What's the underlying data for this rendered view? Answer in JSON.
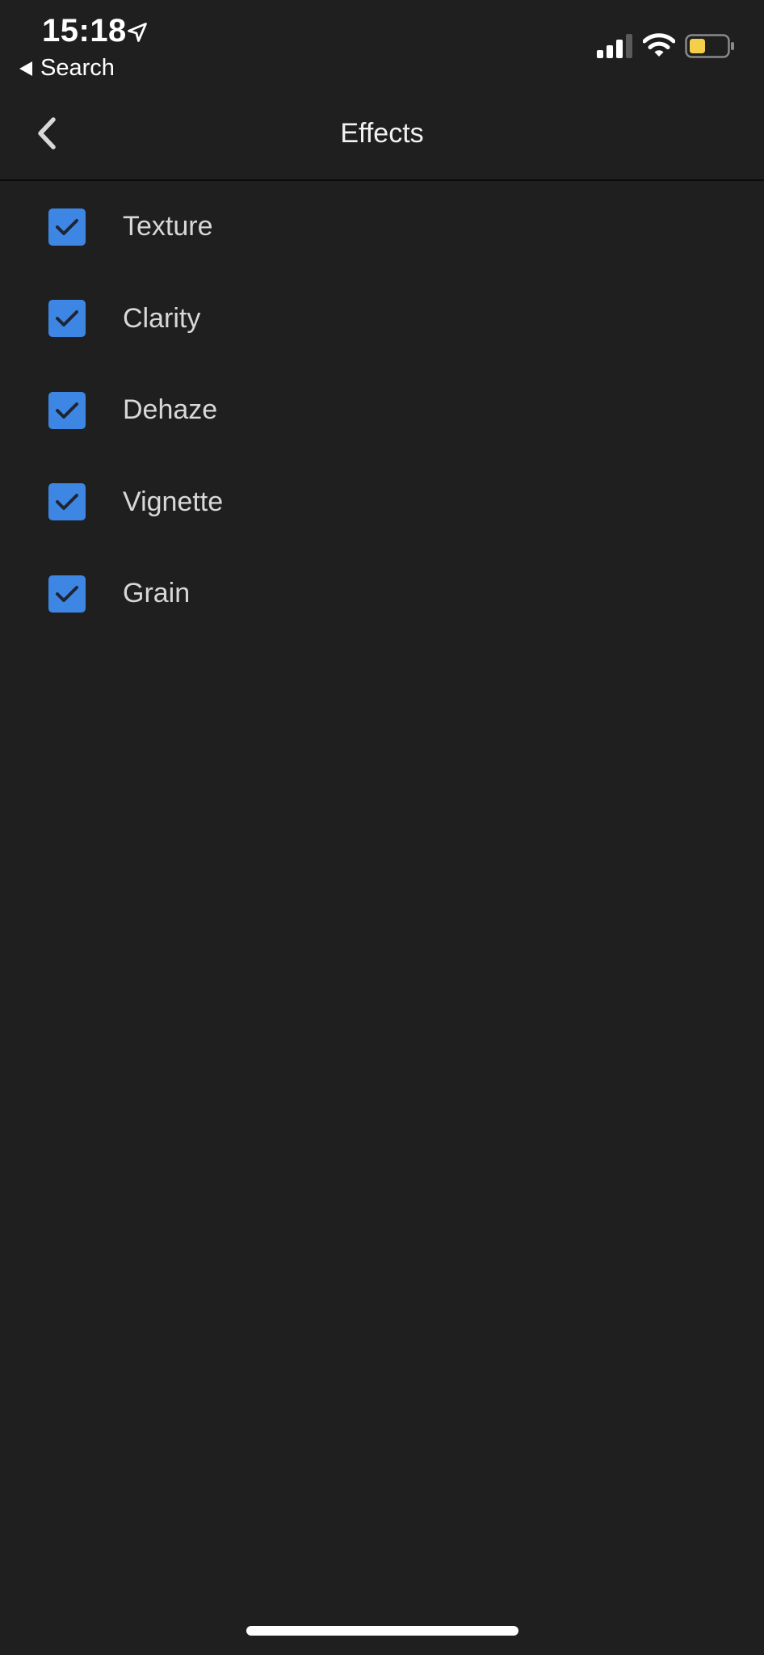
{
  "status_bar": {
    "time": "15:18",
    "back_app_label": "Search",
    "icons": [
      "location-arrow-icon",
      "cellular-signal-icon",
      "wifi-icon",
      "battery-icon"
    ],
    "battery_color": "#f5cf4a"
  },
  "nav": {
    "title": "Effects",
    "back_icon": "chevron-left-icon"
  },
  "effects": [
    {
      "label": "Texture",
      "checked": true
    },
    {
      "label": "Clarity",
      "checked": true
    },
    {
      "label": "Dehaze",
      "checked": true
    },
    {
      "label": "Vignette",
      "checked": true
    },
    {
      "label": "Grain",
      "checked": true
    }
  ],
  "colors": {
    "background": "#1f1f1f",
    "checkbox": "#3d86e3",
    "checkmark": "#1f2533",
    "text": "#d8d8d8"
  }
}
